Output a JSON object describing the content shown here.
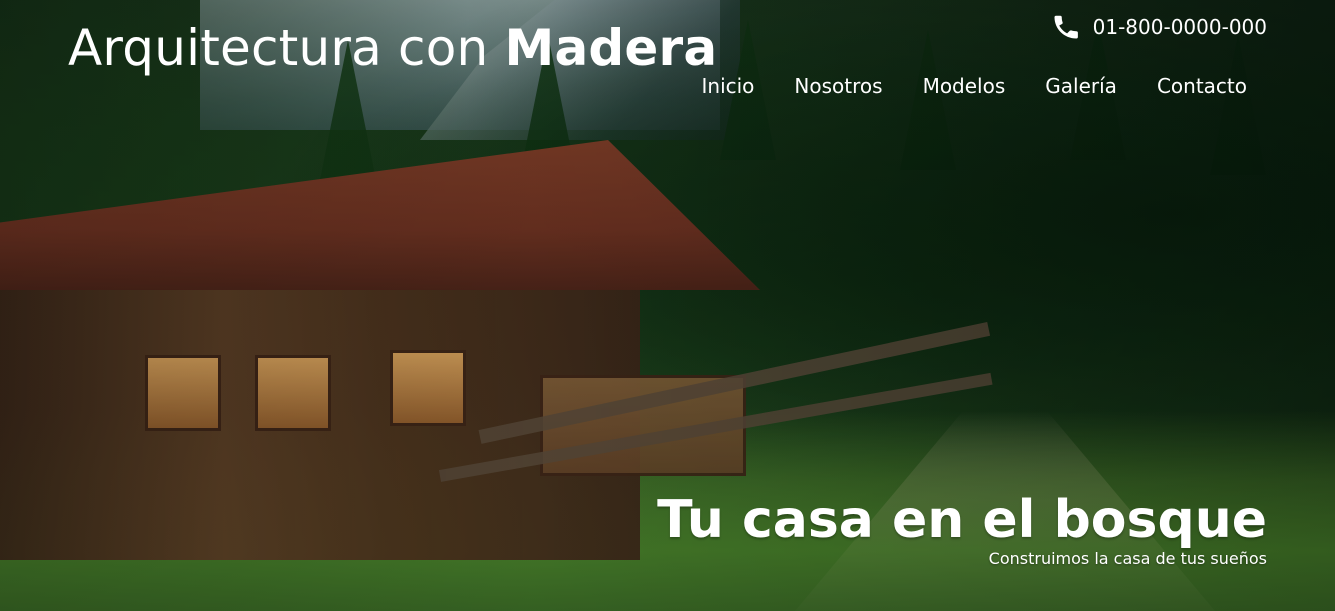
{
  "brand": {
    "light": "Arquitectura con",
    "bold": "Madera"
  },
  "contact": {
    "phone_icon": "phone-icon",
    "phone_number": "01-800-0000-000"
  },
  "nav": {
    "items": [
      "Inicio",
      "Nosotros",
      "Modelos",
      "Galería",
      "Contacto"
    ]
  },
  "hero": {
    "title": "Tu casa en el bosque",
    "subtitle": "Construimos la casa de tus sueños"
  },
  "colors": {
    "text": "#ffffff"
  }
}
